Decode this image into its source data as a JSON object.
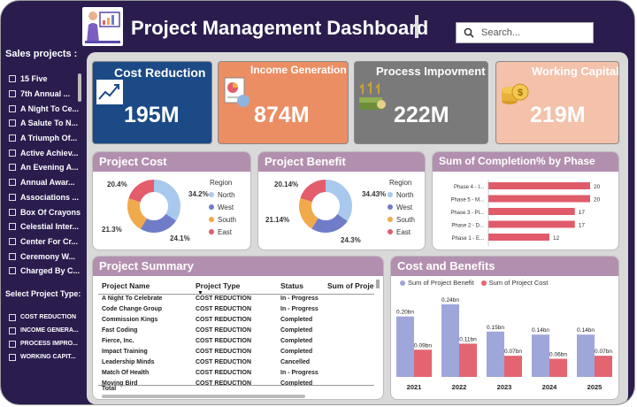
{
  "header": {
    "title": "Project Management Dashboard",
    "search_placeholder": "Search..."
  },
  "slicers": {
    "sales_title": "Sales projects :",
    "sales_items": [
      "15 Five",
      "7th Annual ...",
      "A Night To Ce...",
      "A Salute To N...",
      "A Triumph Of...",
      "Active Achiev...",
      "An Evening A...",
      "Annual Awar...",
      "Associations ...",
      "Box Of Crayons",
      "Celestial Inter...",
      "Center For Cr...",
      "Ceremony W...",
      "Charged By C..."
    ],
    "type_title": "Select Project Type:",
    "type_items": [
      "COST REDUCTION",
      "INCOME GENERA...",
      "PROCESS IMPRO...",
      "WORKING CAPIT..."
    ]
  },
  "kpis": [
    {
      "title": "Cost Reduction",
      "value": "195M",
      "bg": "#1b4a86",
      "title_color": "#ffffff"
    },
    {
      "title": "Income Generation",
      "value": "874M",
      "bg": "#ec8e63",
      "title_color": "#ffffff"
    },
    {
      "title": "Process Impovment",
      "value": "222M",
      "bg": "#7a7a7a",
      "title_color": "#ffffff"
    },
    {
      "title": "Working Capital",
      "value": "219M",
      "bg": "#f4c1ab",
      "title_color": "#ffffff"
    }
  ],
  "colors": {
    "north": "#a9c8ee",
    "west": "#6f7dc8",
    "south": "#f0a94b",
    "east": "#e35d6a",
    "benefit": "#9fa6da",
    "cost": "#e36571",
    "phase_bar": "#e05b6a",
    "card_head": "#b28fae"
  },
  "project_cost": {
    "title": "Project Cost",
    "legend_title": "Region",
    "legend": [
      "North",
      "West",
      "South",
      "East"
    ],
    "slices": [
      {
        "region": "North",
        "pct": 34.2,
        "label": "34.2%"
      },
      {
        "region": "West",
        "pct": 24.1,
        "label": "24.1%"
      },
      {
        "region": "South",
        "pct": 21.3,
        "label": "21.3%"
      },
      {
        "region": "East",
        "pct": 20.4,
        "label": "20.4%"
      }
    ]
  },
  "project_benefit": {
    "title": "Project Benefit",
    "legend_title": "Region",
    "legend": [
      "North",
      "West",
      "South",
      "East"
    ],
    "slices": [
      {
        "region": "North",
        "pct": 34.43,
        "label": "34.43%"
      },
      {
        "region": "West",
        "pct": 24.3,
        "label": "24.3%"
      },
      {
        "region": "South",
        "pct": 21.14,
        "label": "21.14%"
      },
      {
        "region": "East",
        "pct": 20.14,
        "label": "20.14%"
      }
    ]
  },
  "phase_chart": {
    "title": "Sum of Completion% by Phase",
    "labels": [
      "Phase 4 - I...",
      "Phase 5 - M...",
      "Phase 3 - Pl...",
      "Phase 2 - D...",
      "Phase 1 - E..."
    ],
    "values": [
      20,
      20,
      17,
      17,
      12
    ]
  },
  "summary": {
    "title": "Project Summary",
    "columns": [
      "Project Name",
      "Project Type",
      "Status",
      "Sum of Proje"
    ],
    "rows": [
      [
        "A Night To Celebrate",
        "COST REDUCTION",
        "In - Progress"
      ],
      [
        "Code Change Group",
        "COST REDUCTION",
        "In - Progress"
      ],
      [
        "Commission Kings",
        "COST REDUCTION",
        "Completed"
      ],
      [
        "Fast Coding",
        "COST REDUCTION",
        "Completed"
      ],
      [
        "Fierce, Inc.",
        "COST REDUCTION",
        "Completed"
      ],
      [
        "Impact Training",
        "COST REDUCTION",
        "Completed"
      ],
      [
        "Leadership Minds",
        "COST REDUCTION",
        "Cancelled"
      ],
      [
        "Match Of Health",
        "COST REDUCTION",
        "In - Progress"
      ],
      [
        "Moving Bird",
        "COST REDUCTION",
        "Completed"
      ]
    ],
    "total_label": "Total"
  },
  "chart_data": {
    "type": "bar",
    "title": "Cost and Benefits",
    "categories": [
      "2021",
      "2022",
      "2023",
      "2024",
      "2025"
    ],
    "series": [
      {
        "name": "Sum of Project Benefit",
        "values": [
          0.2,
          0.24,
          0.15,
          0.14,
          0.14
        ],
        "labels": [
          "0.20bn",
          "0.24bn",
          "0.15bn",
          "0.14bn",
          "0.14bn"
        ]
      },
      {
        "name": "Sum of Project Cost",
        "values": [
          0.09,
          0.11,
          0.07,
          0.06,
          0.07
        ],
        "labels": [
          "0.09bn",
          "0.11bn",
          "0.07bn",
          "0.06bn",
          "0.07bn"
        ]
      }
    ],
    "ylim": [
      0,
      0.24
    ]
  }
}
